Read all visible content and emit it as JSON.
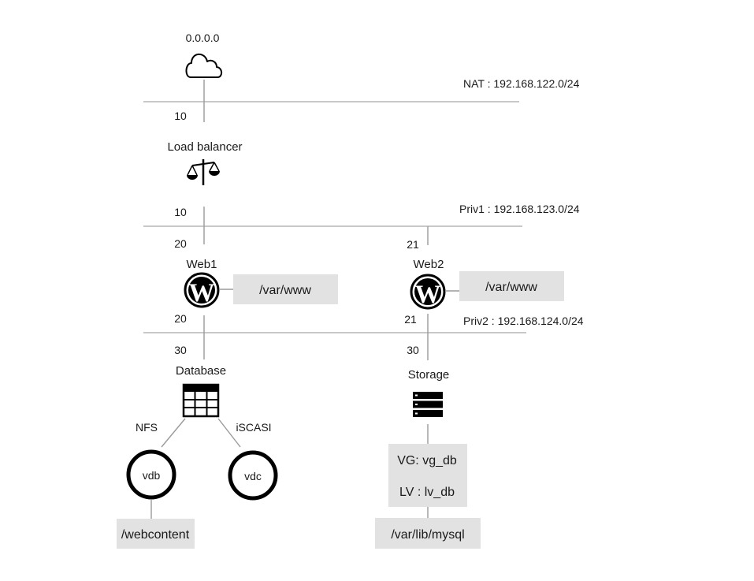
{
  "networks": {
    "nat": "NAT : 192.168.122.0/24",
    "priv1": "Priv1 : 192.168.123.0/24",
    "priv2": "Priv2 : 192.168.124.0/24"
  },
  "internet": {
    "address": "0.0.0.0",
    "icon": "cloud-icon"
  },
  "load_balancer": {
    "label": "Load balancer",
    "icon": "scales-icon",
    "addr_nat": "10",
    "addr_priv1": "10"
  },
  "web1": {
    "label": "Web1",
    "icon": "wordpress-icon",
    "addr_priv1": "20",
    "addr_priv2": "20",
    "mount": "/var/www"
  },
  "web2": {
    "label": "Web2",
    "icon": "wordpress-icon",
    "addr_priv1": "21",
    "addr_priv2": "21",
    "mount": "/var/www"
  },
  "database": {
    "label": "Database",
    "icon": "table-icon",
    "addr_priv2": "30",
    "nfs_label": "NFS",
    "iscsi_label": "iSCASI",
    "disk_vdb": "vdb",
    "disk_vdc": "vdc",
    "mount": "/webcontent"
  },
  "storage": {
    "label": "Storage",
    "icon": "server-stack-icon",
    "addr_priv2": "30",
    "vg": "VG: vg_db",
    "lv": "LV : lv_db",
    "mount": "/var/lib/mysql"
  },
  "colors": {
    "line": "#b5b5b5",
    "box": "#e2e2e2",
    "text": "#1a1a1a",
    "icon": "#000000"
  }
}
